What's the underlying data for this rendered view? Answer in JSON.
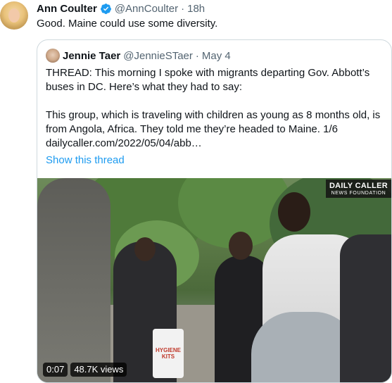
{
  "tweet": {
    "author_name": "Ann Coulter",
    "author_handle": "@AnnCoulter",
    "separator": "·",
    "time": "18h",
    "text": "Good.  Maine could use some diversity."
  },
  "quoted_tweet": {
    "author_name": "Jennie Taer",
    "author_handle": "@JennieSTaer",
    "separator": "·",
    "date": "May 4",
    "text_line1": "THREAD: This morning I spoke with migrants departing Gov. Abbott’s",
    "text_line2": "buses in DC. Here’s what they had to say:",
    "text_line3": "This group, which is traveling with children as young as 8 months old, is",
    "text_line4": "from Angola, Africa. They told me they’re headed to Maine. 1/6",
    "text_line5": "dailycaller.com/2022/05/04/abb…",
    "show_thread": "Show this thread",
    "media": {
      "watermark_line1": "DAILY CALLER",
      "watermark_line2": "NEWS FOUNDATION",
      "sign_text": "HYGIENE KITS",
      "duration": "0:07",
      "views": "48.7K views"
    }
  }
}
